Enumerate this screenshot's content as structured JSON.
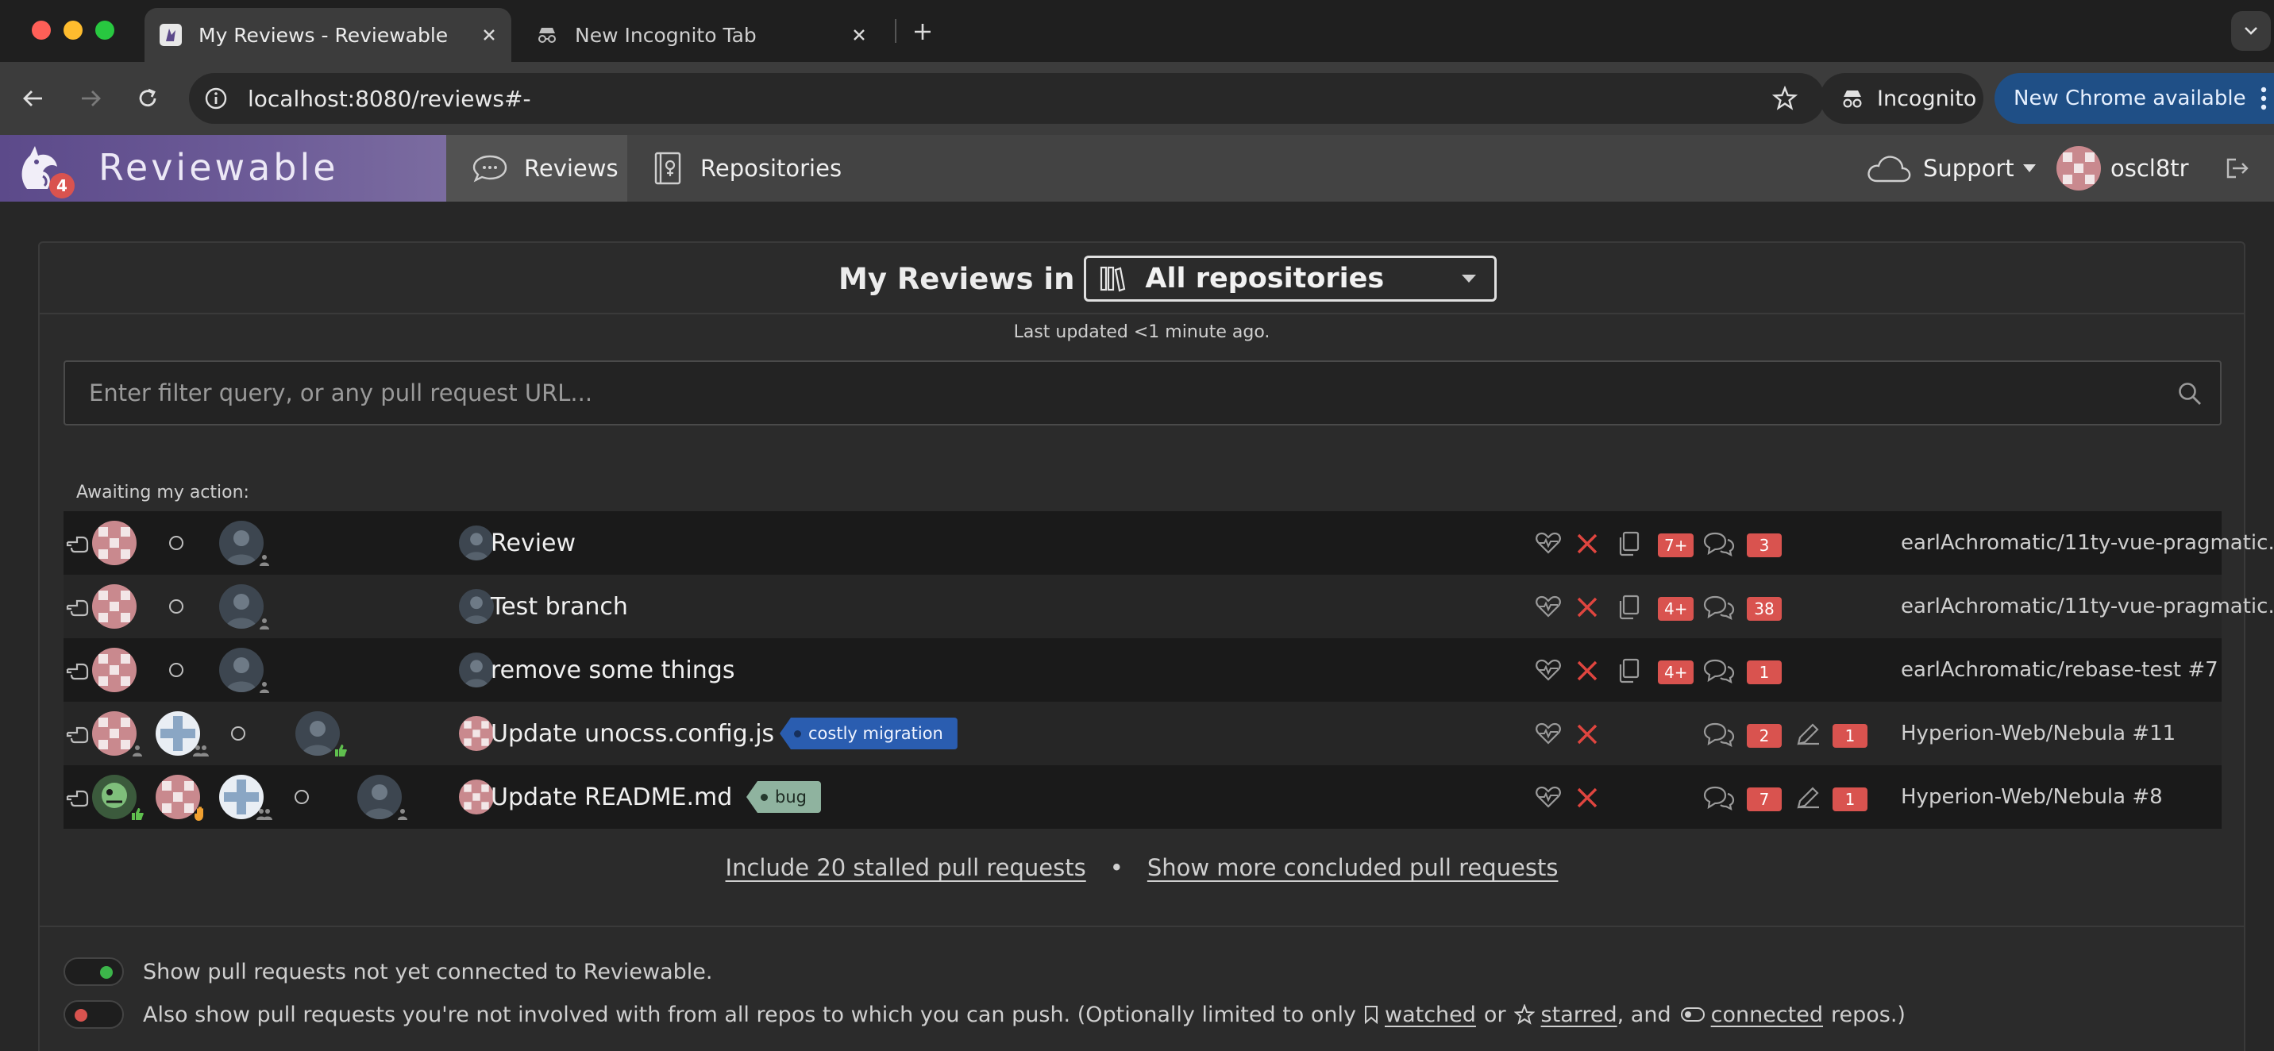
{
  "browser": {
    "tabs": [
      {
        "title": "My Reviews - Reviewable",
        "active": true
      },
      {
        "title": "New Incognito Tab",
        "active": false
      }
    ],
    "url": "localhost:8080/reviews#-",
    "incognito_label": "Incognito",
    "update_label": "New Chrome available"
  },
  "app": {
    "brand": "Reviewable",
    "logo_badge": "4",
    "nav": {
      "reviews": "Reviews",
      "repositories": "Repositories"
    },
    "support": "Support",
    "username": "oscl8tr"
  },
  "page": {
    "title_prefix": "My Reviews in",
    "repo_filter": "All repositories",
    "last_updated": "Last updated <1 minute ago.",
    "filter_placeholder": "Enter filter query, or any pull request URL...",
    "section_label": "Awaiting my action:"
  },
  "reviews": [
    {
      "title": "Review",
      "file_count": "7+",
      "comments": "3",
      "repo": "earlAchromatic/11ty-vue-pragmatic..."
    },
    {
      "title": "Test branch",
      "file_count": "4+",
      "comments": "38",
      "repo": "earlAchromatic/11ty-vue-pragmatic..."
    },
    {
      "title": "remove some things",
      "file_count": "4+",
      "comments": "1",
      "repo": "earlAchromatic/rebase-test #7"
    },
    {
      "title": "Update unocss.config.js",
      "label": "costly migration",
      "comments": "2",
      "drafts": "1",
      "repo": "Hyperion-Web/Nebula #11"
    },
    {
      "title": "Update README.md",
      "label": "bug",
      "comments": "7",
      "drafts": "1",
      "repo": "Hyperion-Web/Nebula #8"
    }
  ],
  "footer": {
    "stalled": "Include 20 stalled pull requests",
    "bullet": "•",
    "concluded": "Show more concluded pull requests"
  },
  "options": {
    "opt1": "Show pull requests not yet connected to Reviewable.",
    "opt2_prefix": "Also show pull requests you're not involved with from all repos to which you can push. (Optionally limited to only",
    "watched": "watched",
    "or": "or",
    "starred": "starred",
    "and": ", and",
    "connected": "connected",
    "suffix": "repos.)"
  },
  "colors": {
    "brand_purple": "#5c4a8a",
    "badge_red": "#d9534f",
    "label_blue": "#2a5db0",
    "label_bug": "#8fb39f",
    "toggle_on": "#3cb54a",
    "toggle_off": "#d9534f",
    "update_blue": "#1f4f86"
  },
  "icons": [
    "reviewable-logo",
    "comment-icon",
    "repo-book-icon",
    "cloud-icon",
    "signout-icon",
    "search-icon",
    "pointing-hand-icon",
    "heartbeat-icon",
    "x-icon",
    "files-icon",
    "comments-icon",
    "pencil-icon"
  ]
}
